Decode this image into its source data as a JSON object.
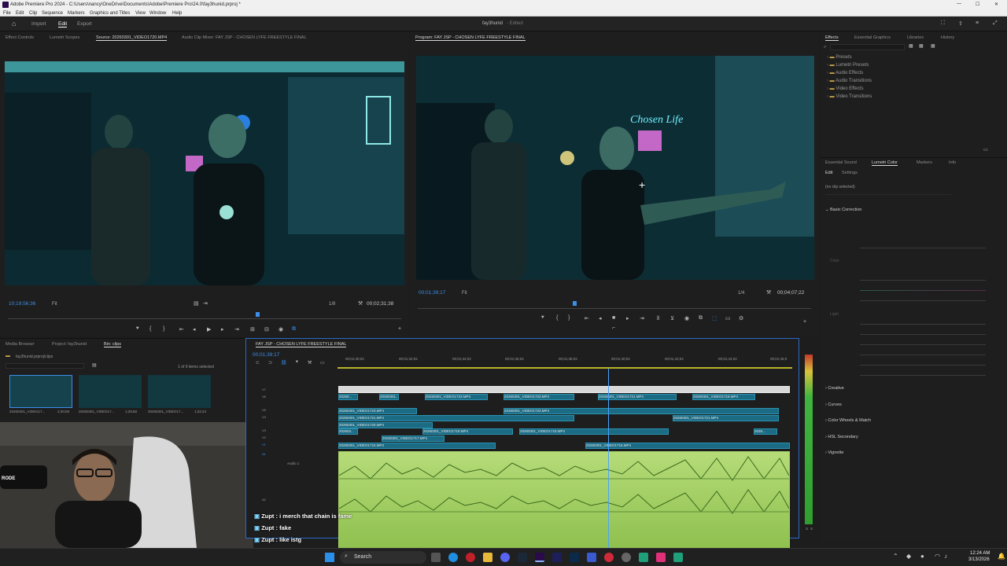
{
  "window": {
    "title": "Adobe Premiere Pro 2024 - C:\\Users\\nancy\\OneDrive\\Documents\\Adobe\\Premiere Pro\\24.0\\fay3hunid.prproj *",
    "controls": [
      "—",
      "☐",
      "✕"
    ]
  },
  "menu": [
    "File",
    "Edit",
    "Clip",
    "Sequence",
    "Markers",
    "Graphics and Titles",
    "View",
    "Window",
    "Help"
  ],
  "workspace": {
    "tabs": [
      "Import",
      "Edit",
      "Export"
    ],
    "project_title": "fay3hunid",
    "edited_label": "- Edited"
  },
  "source_panel": {
    "tabs": [
      "Effect Controls",
      "Lumetri Scopes",
      "Source: 20260301_VIDEO1720.MP4",
      "Audio Clip Mixer: FAY JSP - CHOSEN LYFE FREESTYLE FINAL"
    ],
    "timecode": "10;19;56;36",
    "fit": "Fit",
    "resolution": "1/8",
    "duration": "00;02;31;38"
  },
  "program_panel": {
    "tab": "Program: FAY JSP - CHOSEN LYFE FREESTYLE FINAL",
    "timecode": "00;01;39;17",
    "fit": "Fit",
    "resolution": "1/4",
    "duration": "00;04;07;22"
  },
  "effects_panel": {
    "tabs": [
      "Effects",
      "Essential Graphics",
      "Libraries",
      "History"
    ],
    "folders": [
      "Presets",
      "Lumetri Presets",
      "Audio Effects",
      "Audio Transitions",
      "Video Effects",
      "Video Transitions"
    ]
  },
  "lumetri_panel": {
    "tabs": [
      "Essential Sound",
      "Lumetri Color",
      "Markers",
      "Info"
    ],
    "subtabs": [
      "Edit",
      "Settings"
    ],
    "no_clip": "(no clip selected)",
    "sections": [
      "Basic Correction",
      "Creative",
      "Curves",
      "Color Wheels & Match",
      "HSL Secondary",
      "Vignette"
    ],
    "color_label": "Color",
    "light_label": "Light"
  },
  "project_panel": {
    "tabs": [
      "Media Browser",
      "Project: fay3hunid",
      "Bin: clips"
    ],
    "bin_path": "fay3hunid.prproj\\clips",
    "selection": "1 of 9 items selected",
    "thumbs": [
      {
        "name": "20260301_VIDEO17...",
        "dur": "2;30;08"
      },
      {
        "name": "20260301_VIDEO17...",
        "dur": "1;29;58"
      },
      {
        "name": "20260301_VIDEO17...",
        "dur": "1;32;24"
      }
    ]
  },
  "timeline": {
    "tab": "FAY JSP - CHOSEN LYFE FREESTYLE FINAL",
    "timecode": "00;01;39;17",
    "ruler": [
      "00;01;30;02",
      "00;01;32;02",
      "00;01;34;02",
      "00;01;36;02",
      "00;01;38;02",
      "00;01;40;02",
      "00;01;42;02",
      "00;01;44;02",
      "00;01;46;0"
    ],
    "track_labels": [
      "V7",
      "V6",
      "V5",
      "V4",
      "V3",
      "V2",
      "V1",
      "A1",
      "A2"
    ],
    "audio_label": "Audio 1",
    "clips": [
      "20260...",
      "20260301...",
      "20260301_VIDEO1723.MP4",
      "20260301_VIDEO1723.MP4",
      "20260301_VIDEO1721.MP4",
      "20260301_VIDEO1718.MP4",
      "20260301_VIDEO1723.MP4",
      "20260301_VIDEO1723.MP4",
      "20260301_VIDEO1721.MP4",
      "20260301_VIDEO1721.MP4",
      "20260301_VIDEO1720.MP4",
      "202603...",
      "20260301_VIDEO1718.MP4",
      "20260301_VIDEO1718.MP4",
      "2026...",
      "20260301_VIDEO1717.MP4",
      "20260301_VIDEO1716.MP4",
      "20260301_VIDEO1716.MP4"
    ],
    "meter_labels": [
      "S",
      "S"
    ]
  },
  "chat": [
    {
      "user": "Zupt",
      "msg": "i merch that chain is fame"
    },
    {
      "user": "Zupt",
      "msg": "fake"
    },
    {
      "user": "Zupt",
      "msg": "like istg"
    }
  ],
  "webcam": {
    "mic_brand": "RODE"
  },
  "taskbar": {
    "search": "Search",
    "time": "12:24 AM",
    "date": "3/13/2026"
  },
  "colors": {
    "accent_blue": "#3d8ee8",
    "clip_blue": "#1c6b84",
    "audio_green": "#a6cf62",
    "panel_bg": "#1e1e1e"
  }
}
